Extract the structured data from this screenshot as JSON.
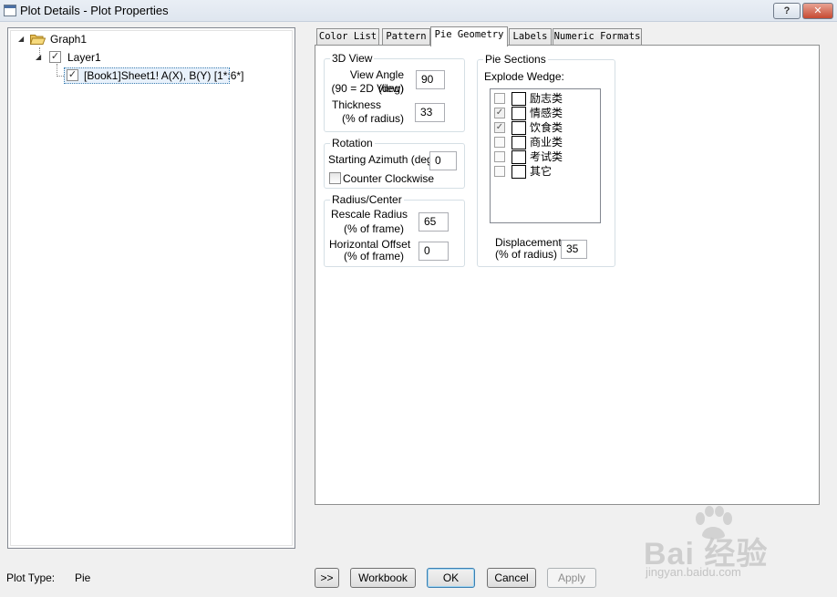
{
  "window": {
    "title": "Plot Details - Plot Properties",
    "help_button": "?",
    "close_button": "✕"
  },
  "tree": {
    "graph": "Graph1",
    "layer": "Layer1",
    "plot": "[Book1]Sheet1! A(X), B(Y) [1*:6*]"
  },
  "tabs": [
    {
      "label": "Color List"
    },
    {
      "label": "Pattern"
    },
    {
      "label": "Pie Geometry",
      "active": true
    },
    {
      "label": "Labels"
    },
    {
      "label": "Numeric Formats"
    }
  ],
  "view3d": {
    "title": "3D View",
    "view_angle_label": "View Angle (deg)",
    "view_angle_sub": "(90 = 2D View)",
    "view_angle_value": "90",
    "thickness_label": "Thickness",
    "thickness_sub": "(% of radius)",
    "thickness_value": "33"
  },
  "rotation": {
    "title": "Rotation",
    "azimuth_label": "Starting Azimuth (deg)",
    "azimuth_value": "0",
    "ccw_label": "Counter Clockwise",
    "ccw_checked": false
  },
  "radius": {
    "title": "Radius/Center",
    "rescale_label": "Rescale Radius",
    "rescale_sub": "(% of frame)",
    "rescale_value": "65",
    "offset_label": "Horizontal Offset",
    "offset_sub": "(% of frame)",
    "offset_value": "0"
  },
  "pie_sections": {
    "title": "Pie Sections",
    "explode_label": "Explode Wedge:",
    "wedges": [
      {
        "label": "励志类",
        "checked": false
      },
      {
        "label": "情感类",
        "checked": true
      },
      {
        "label": "饮食类",
        "checked": true
      },
      {
        "label": "商业类",
        "checked": false
      },
      {
        "label": "考试类",
        "checked": false
      },
      {
        "label": "其它",
        "checked": false
      }
    ],
    "displacement_label": "Displacement",
    "displacement_sub": "(% of radius)",
    "displacement_value": "35"
  },
  "footer": {
    "plot_type_label": "Plot Type:",
    "plot_type_value": "Pie",
    "expand_button": ">>",
    "workbook_button": "Workbook",
    "ok_button": "OK",
    "cancel_button": "Cancel",
    "apply_button": "Apply"
  },
  "watermark": {
    "brand": "Bai 经验",
    "url": "jingyan.baidu.com"
  }
}
